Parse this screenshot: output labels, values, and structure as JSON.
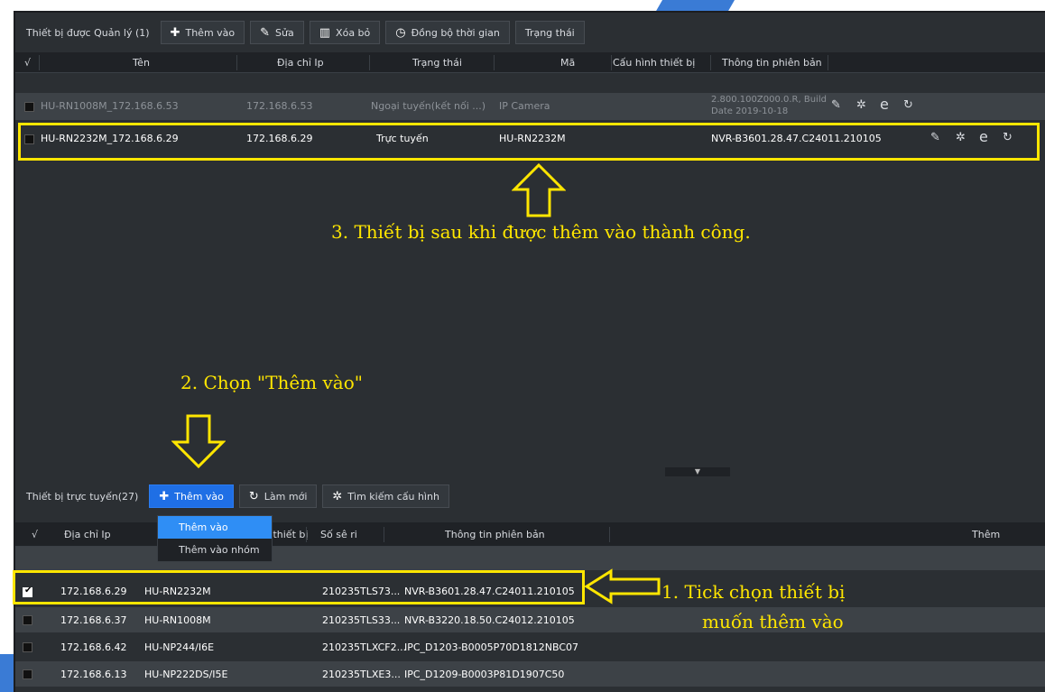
{
  "managed": {
    "title": "Thiết bị được Quản lý (1)",
    "buttons": [
      {
        "label": "Thêm vào",
        "icon": "plus-icon"
      },
      {
        "label": "Sửa",
        "icon": "pencil-icon"
      },
      {
        "label": "Xóa bỏ",
        "icon": "trash-icon"
      },
      {
        "label": "Đồng bộ thời gian",
        "icon": "clock-icon"
      },
      {
        "label": "Trạng thái",
        "icon": ""
      }
    ],
    "columns": [
      "√",
      "Tên",
      "Địa chỉ Ip",
      "Trạng thái",
      "Mã",
      "Cấu hình thiết bị",
      "Thông tin phiên bản"
    ],
    "rows": [
      {
        "name": "HU-RN1008M_172.168.6.53",
        "ip": "172.168.6.53",
        "status": "Ngoại tuyến(kết nối ...)",
        "code": "IP Camera",
        "version_line1": "2.800.100Z000.0.R, Build",
        "version_line2": "Date 2019-10-18"
      },
      {
        "name": "HU-RN2232M_172.168.6.29",
        "ip": "172.168.6.29",
        "status": "Trực tuyến",
        "code": "HU-RN2232M",
        "version_line1": "NVR-B3601.28.47.C24011.210105",
        "version_line2": ""
      }
    ]
  },
  "online": {
    "title": "Thiết bị trực tuyến(27)",
    "buttons": [
      {
        "label": "Thêm vào",
        "icon": "plus-icon"
      },
      {
        "label": "Làm mới",
        "icon": "refresh-icon"
      },
      {
        "label": "Tìm kiếm cấu hình",
        "icon": "gear-icon"
      }
    ],
    "columns": [
      "√",
      "Địa chỉ Ip",
      "n thiết bị",
      "Số sê ri",
      "Thông tin phiên bản",
      "Thêm"
    ],
    "dropdown": [
      "Thêm vào",
      "Thêm vào nhóm"
    ],
    "rows": [
      {
        "checked": true,
        "ip": "172.168.6.29",
        "model": "HU-RN2232M",
        "serial": "210235TLS73...",
        "version": "NVR-B3601.28.47.C24011.210105"
      },
      {
        "checked": false,
        "ip": "172.168.6.37",
        "model": "HU-RN1008M",
        "serial": "210235TLS33...",
        "version": "NVR-B3220.18.50.C24012.210105"
      },
      {
        "checked": false,
        "ip": "172.168.6.42",
        "model": "HU-NP244/I6E",
        "serial": "210235TLXCF2...",
        "version": "IPC_D1203-B0005P70D1812NBC07"
      },
      {
        "checked": false,
        "ip": "172.168.6.13",
        "model": "HU-NP222DS/I5E",
        "serial": "210235TLXE3...",
        "version": "IPC_D1209-B0003P81D1907C50"
      }
    ]
  },
  "annotations": {
    "step1_line1": "1. Tick chọn thiết bị",
    "step1_line2": "muốn thêm vào",
    "step2": "2. Chọn \"Thêm vào\"",
    "step3": "3. Thiết bị sau khi được thêm vào thành công."
  },
  "colors": {
    "highlight": "#ffe600",
    "accent": "#1f6fe5"
  }
}
